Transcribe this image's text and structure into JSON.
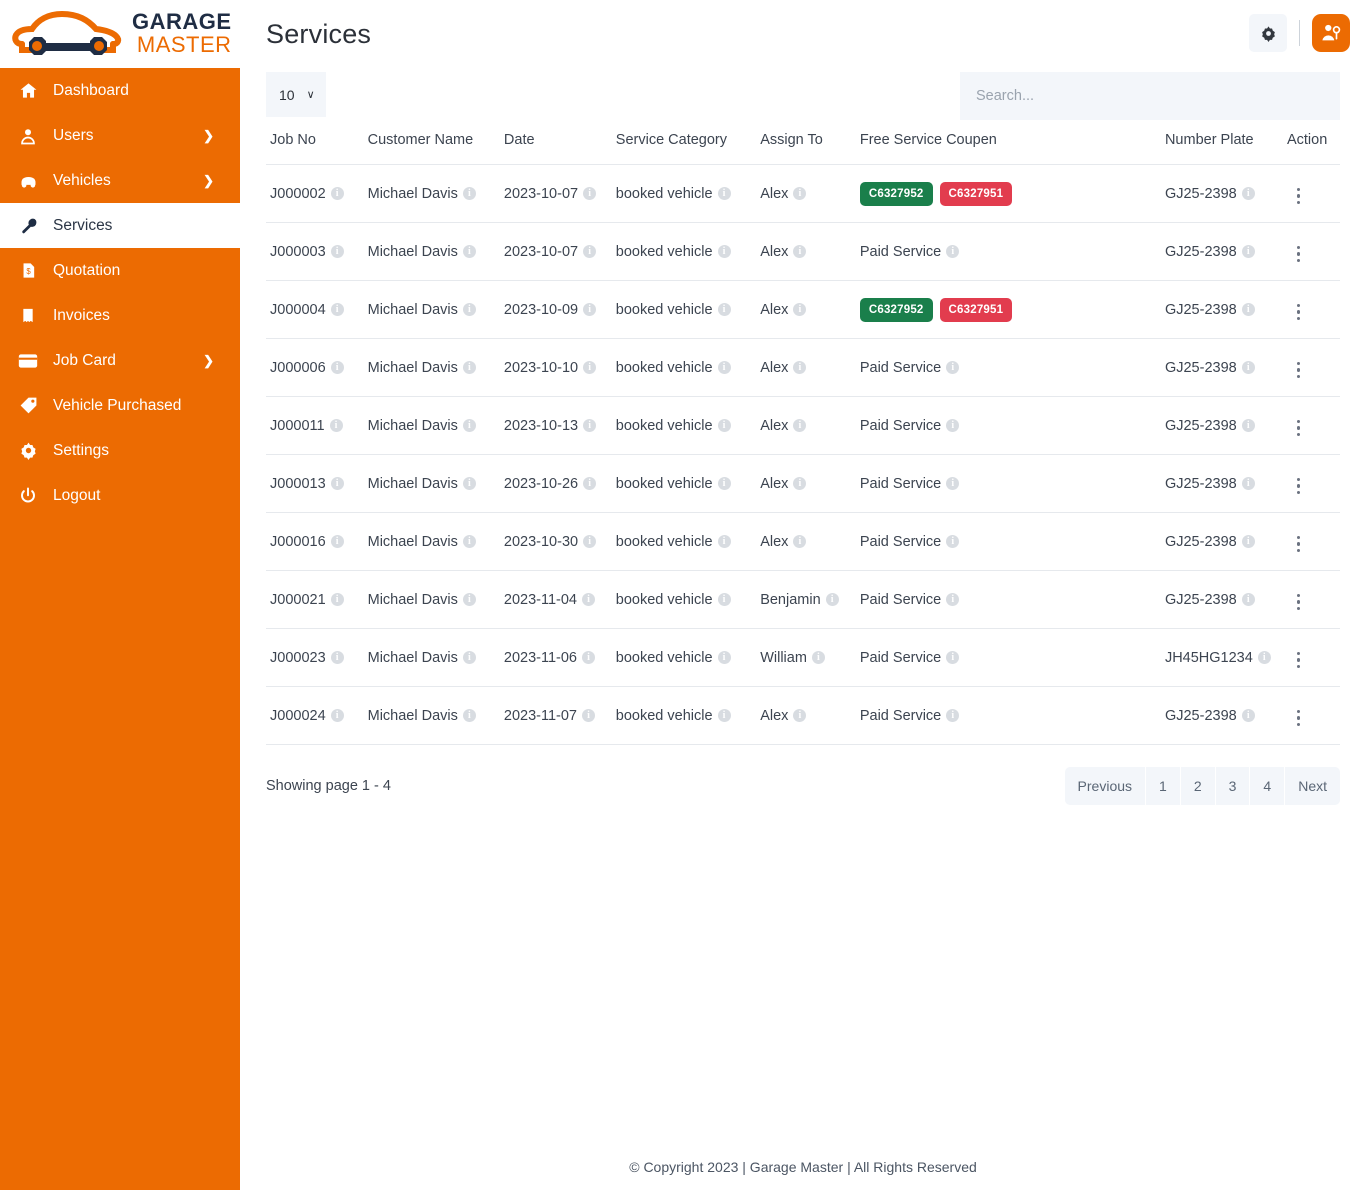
{
  "brand": {
    "name_line1": "GARAGE",
    "name_line2": "MASTER",
    "logo_icon": "car-wrench-logo-icon",
    "accent_color": "#ec6b02",
    "dark_color": "#1f2d44"
  },
  "sidebar": {
    "items": [
      {
        "label": "Dashboard",
        "icon": "home-icon",
        "has_caret": false,
        "active": false
      },
      {
        "label": "Users",
        "icon": "user-icon",
        "has_caret": true,
        "active": false
      },
      {
        "label": "Vehicles",
        "icon": "car-icon",
        "has_caret": true,
        "active": false
      },
      {
        "label": "Services",
        "icon": "wrench-icon",
        "has_caret": false,
        "active": true
      },
      {
        "label": "Quotation",
        "icon": "document-dollar-icon",
        "has_caret": false,
        "active": false
      },
      {
        "label": "Invoices",
        "icon": "receipt-icon",
        "has_caret": false,
        "active": false
      },
      {
        "label": "Job Card",
        "icon": "card-icon",
        "has_caret": true,
        "active": false
      },
      {
        "label": "Vehicle Purchased",
        "icon": "tag-icon",
        "has_caret": false,
        "active": false
      },
      {
        "label": "Settings",
        "icon": "gear-icon",
        "has_caret": false,
        "active": false
      },
      {
        "label": "Logout",
        "icon": "power-icon",
        "has_caret": false,
        "active": false
      }
    ],
    "caret_glyph": "❯"
  },
  "header": {
    "title": "Services",
    "gear_button_icon": "gear-icon",
    "profile_button_icon": "mechanic-profile-icon"
  },
  "controls": {
    "entries_value": "10",
    "entries_chevron": "∨",
    "search_placeholder": "Search...",
    "search_value": ""
  },
  "table": {
    "columns": [
      "Job No",
      "Customer Name",
      "Date",
      "Service Category",
      "Assign To",
      "Free Service Coupen",
      "Number Plate",
      "Action"
    ],
    "info_glyph": "i",
    "rows": [
      {
        "job_no": "J000002",
        "customer": "Michael Davis",
        "date": "2023-10-07",
        "category": "booked vehicle",
        "assign_to": "Alex",
        "coupon_type": "badges",
        "coupons": [
          {
            "code": "C6327952",
            "color": "green"
          },
          {
            "code": "C6327951",
            "color": "red"
          }
        ],
        "coupon_text": "",
        "plate": "GJ25-2398"
      },
      {
        "job_no": "J000003",
        "customer": "Michael Davis",
        "date": "2023-10-07",
        "category": "booked vehicle",
        "assign_to": "Alex",
        "coupon_type": "text",
        "coupons": [],
        "coupon_text": "Paid Service",
        "plate": "GJ25-2398"
      },
      {
        "job_no": "J000004",
        "customer": "Michael Davis",
        "date": "2023-10-09",
        "category": "booked vehicle",
        "assign_to": "Alex",
        "coupon_type": "badges",
        "coupons": [
          {
            "code": "C6327952",
            "color": "green"
          },
          {
            "code": "C6327951",
            "color": "red"
          }
        ],
        "coupon_text": "",
        "plate": "GJ25-2398"
      },
      {
        "job_no": "J000006",
        "customer": "Michael Davis",
        "date": "2023-10-10",
        "category": "booked vehicle",
        "assign_to": "Alex",
        "coupon_type": "text",
        "coupons": [],
        "coupon_text": "Paid Service",
        "plate": "GJ25-2398"
      },
      {
        "job_no": "J000011",
        "customer": "Michael Davis",
        "date": "2023-10-13",
        "category": "booked vehicle",
        "assign_to": "Alex",
        "coupon_type": "text",
        "coupons": [],
        "coupon_text": "Paid Service",
        "plate": "GJ25-2398"
      },
      {
        "job_no": "J000013",
        "customer": "Michael Davis",
        "date": "2023-10-26",
        "category": "booked vehicle",
        "assign_to": "Alex",
        "coupon_type": "text",
        "coupons": [],
        "coupon_text": "Paid Service",
        "plate": "GJ25-2398"
      },
      {
        "job_no": "J000016",
        "customer": "Michael Davis",
        "date": "2023-10-30",
        "category": "booked vehicle",
        "assign_to": "Alex",
        "coupon_type": "text",
        "coupons": [],
        "coupon_text": "Paid Service",
        "plate": "GJ25-2398"
      },
      {
        "job_no": "J000021",
        "customer": "Michael Davis",
        "date": "2023-11-04",
        "category": "booked vehicle",
        "assign_to": "Benjamin",
        "coupon_type": "text",
        "coupons": [],
        "coupon_text": "Paid Service",
        "plate": "GJ25-2398"
      },
      {
        "job_no": "J000023",
        "customer": "Michael Davis",
        "date": "2023-11-06",
        "category": "booked vehicle",
        "assign_to": "William",
        "coupon_type": "text",
        "coupons": [],
        "coupon_text": "Paid Service",
        "plate": "JH45HG1234"
      },
      {
        "job_no": "J000024",
        "customer": "Michael Davis",
        "date": "2023-11-07",
        "category": "booked vehicle",
        "assign_to": "Alex",
        "coupon_type": "text",
        "coupons": [],
        "coupon_text": "Paid Service",
        "plate": "GJ25-2398"
      }
    ]
  },
  "pagination": {
    "showing_text": "Showing page 1 - 4",
    "buttons": [
      "Previous",
      "1",
      "2",
      "3",
      "4",
      "Next"
    ]
  },
  "footer": {
    "text": "© Copyright 2023 | Garage Master | All Rights Reserved"
  }
}
